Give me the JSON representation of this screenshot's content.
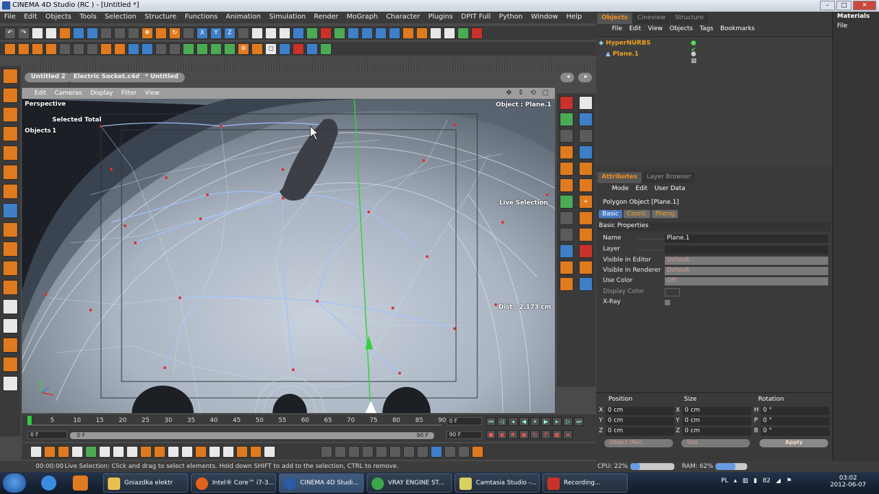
{
  "window": {
    "title": "CINEMA 4D Studio (RC ) - [Untitled *]"
  },
  "menu": [
    "File",
    "Edit",
    "Objects",
    "Tools",
    "Selection",
    "Structure",
    "Functions",
    "Animation",
    "Simulation",
    "Render",
    "MoGraph",
    "Character",
    "Plugins",
    "DPIT Full",
    "Python",
    "Window",
    "Help"
  ],
  "documents": [
    "Untitled 2",
    "Electric Socket.c4d",
    "* Untitled"
  ],
  "viewport": {
    "menu": [
      "Edit",
      "Cameras",
      "Display",
      "Filter",
      "View"
    ],
    "camera": "Perspective",
    "selected_total": "Selected Total",
    "objects_label": "Objects",
    "objects_count": "1",
    "object_label": "Object : Plane.1",
    "tool_label": "Live Selection",
    "dist_label": "Dist : 2.173 cm"
  },
  "timeline": {
    "ticks": [
      "0",
      "5",
      "10",
      "15",
      "20",
      "25",
      "30",
      "35",
      "40",
      "45",
      "50",
      "55",
      "60",
      "65",
      "70",
      "75",
      "80",
      "85",
      "90"
    ],
    "current_frame": "0 F",
    "start_frame": "0 F",
    "scrub_frame": "0 F",
    "end_frame_a": "90 F",
    "end_frame_b": "90 F",
    "min_frame": "0 F"
  },
  "status": {
    "time": "00:00:00",
    "message": "Live Selection: Click and drag to select elements. Hold down SHIFT to add to the selection, CTRL to remove.",
    "cpu": "CPU: 22%",
    "cpu_fraction": 0.22,
    "ram": "RAM: 62%",
    "ram_fraction": 0.62
  },
  "object_manager": {
    "tabs": [
      "Objects",
      "Cineview",
      "Structure"
    ],
    "menu": [
      "File",
      "Edit",
      "View",
      "Objects",
      "Tags",
      "Bookmarks"
    ],
    "items": [
      {
        "name": "HyperNURBS"
      },
      {
        "name": "Plane.1"
      }
    ]
  },
  "materials": {
    "title": "Materials",
    "menu": "File"
  },
  "attributes": {
    "tabs": [
      "Attributes",
      "Layer Browser"
    ],
    "menu": [
      "Mode",
      "Edit",
      "User Data"
    ],
    "title": "Polygon Object [Plane.1]",
    "subtabs": [
      "Basic",
      "Coord.",
      "Phong"
    ],
    "section": "Basic Properties",
    "props": {
      "name_label": "Name",
      "name_value": "Plane.1",
      "layer_label": "Layer",
      "vis_editor_label": "Visible in Editor",
      "vis_editor_value": "Default",
      "vis_render_label": "Visible in Renderer",
      "vis_render_value": "Default",
      "use_color_label": "Use Color",
      "use_color_value": "Off",
      "display_color_label": "Display Color",
      "xray_label": "X-Ray"
    }
  },
  "coordinates": {
    "headers": [
      "Position",
      "Size",
      "Rotation"
    ],
    "rows": [
      {
        "pk": "X",
        "pv": "0 cm",
        "sk": "X",
        "sv": "0 cm",
        "rk": "H",
        "rv": "0 °"
      },
      {
        "pk": "Y",
        "pv": "0 cm",
        "sk": "Y",
        "sv": "0 cm",
        "rk": "P",
        "rv": "0 °"
      },
      {
        "pk": "Z",
        "pv": "0 cm",
        "sk": "Z",
        "sv": "0 cm",
        "rk": "B",
        "rv": "0 °"
      }
    ],
    "mode": "Object (Rel)",
    "size_mode": "Size",
    "apply": "Apply"
  },
  "taskbar": {
    "tasks": [
      "Gniazdka elektr",
      "Intel® Core™ i7-3...",
      "CINEMA 4D Studi...",
      "VRAY ENGINE ST...",
      "Camtasia Studio -...",
      "Recording..."
    ],
    "lang": "PL",
    "tray_num": "82",
    "time": "03:02",
    "date": "2012-06-07"
  }
}
